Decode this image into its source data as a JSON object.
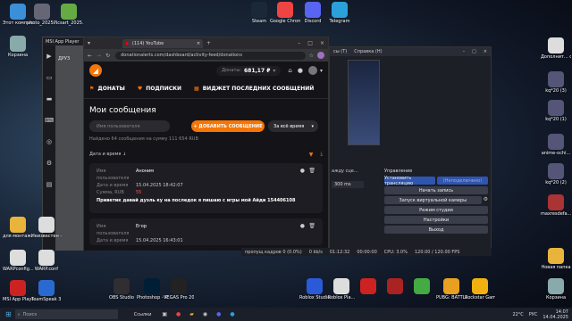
{
  "desktop": {
    "icons_left": [
      {
        "label": "Этот компьютер",
        "icon": "computer-icon",
        "color": "#3b8fd8"
      },
      {
        "label": "photo_2025...",
        "icon": "image-icon",
        "color": "#667"
      },
      {
        "label": "Picsart_2025...",
        "icon": "image-icon",
        "color": "#6a4"
      },
      {
        "label": "Корзина",
        "icon": "trash-icon",
        "color": "#8aa"
      },
      {
        "label": "для монтажа",
        "icon": "folder-icon",
        "color": "#e8b43c"
      },
      {
        "label": "Неизвестен - [Dub]sto...",
        "icon": "file-icon",
        "color": "#ddd"
      },
      {
        "label": "WARPconfig...",
        "icon": "file-icon",
        "color": "#ddd"
      },
      {
        "label": "WARP.conf",
        "icon": "file-icon",
        "color": "#ddd"
      },
      {
        "label": "MSI App Player",
        "icon": "msi-icon",
        "color": "#c22"
      },
      {
        "label": "TeamSpeak 3 Client",
        "icon": "teamspeak-icon",
        "color": "#2a6ad0"
      }
    ],
    "icons_top": [
      {
        "label": "Steam",
        "icon": "steam-icon",
        "color": "#1b2838"
      },
      {
        "label": "Google Chrome",
        "icon": "chrome-icon",
        "color": "#e44"
      },
      {
        "label": "Discord",
        "icon": "discord-icon",
        "color": "#5865f2"
      },
      {
        "label": "Telegram",
        "icon": "telegram-icon",
        "color": "#2aa1da"
      }
    ],
    "icons_right": [
      {
        "label": "Дополнит... сведения...",
        "icon": "file-icon",
        "color": "#ddd"
      },
      {
        "label": "kq*20 (3)",
        "icon": "image-icon",
        "color": "#557"
      },
      {
        "label": "kq*20 (1)",
        "icon": "image-icon",
        "color": "#557"
      },
      {
        "label": "anime-ochi...",
        "icon": "image-icon",
        "color": "#557"
      },
      {
        "label": "kq*20 (2)",
        "icon": "image-icon",
        "color": "#557"
      },
      {
        "label": "maxresdefa...",
        "icon": "image-icon",
        "color": "#a33"
      },
      {
        "label": "Новая папка",
        "icon": "folder-icon",
        "color": "#e8b43c"
      },
      {
        "label": "Корзина",
        "icon": "trash-icon",
        "color": "#8aa"
      }
    ],
    "icons_bottom": [
      {
        "label": "OBS Studio",
        "icon": "obs-icon",
        "color": "#302e31"
      },
      {
        "label": "Photoshop - Ярлык",
        "icon": "photoshop-icon",
        "color": "#001e36"
      },
      {
        "label": "VEGAS Pro 20.0",
        "icon": "vegas-icon",
        "color": "#222"
      },
      {
        "label": "Roblox Studio",
        "icon": "roblox-icon",
        "color": "#2a5ad8"
      },
      {
        "label": "Roblox Pla...",
        "icon": "roblox-icon",
        "color": "#ddd"
      },
      {
        "label": "",
        "icon": "game-icon",
        "color": "#c22"
      },
      {
        "label": "",
        "icon": "game-icon",
        "color": "#a22"
      },
      {
        "label": "",
        "icon": "game-icon",
        "color": "#4a4"
      },
      {
        "label": "PUBG: BATTLEGR...",
        "icon": "pubg-icon",
        "color": "#e8a020"
      },
      {
        "label": "Rockstar Games...",
        "icon": "rockstar-icon",
        "color": "#f0b010"
      }
    ]
  },
  "msi": {
    "title": "MSI App Player",
    "label": "ДРУЗ"
  },
  "browser": {
    "tab_title": "(114) YouTube",
    "url": "donationalerts.com/dashboard/activity-feed/donations"
  },
  "da": {
    "balance_label": "Донаты:",
    "balance_value": "681,17 ₽",
    "nav": [
      "ДОНАТЫ",
      "ПОДПИСКИ",
      "ВИДЖЕТ ПОСЛЕДНИХ СООБЩЕНИЙ"
    ],
    "section_title": "Мои сообщения",
    "search_placeholder": "Имя пользователя",
    "add_button": "+ ДОБАВИТЬ СООБЩЕНИЕ",
    "period": "За всё время",
    "found_text": "Найдено 64 сообщения на сумму 111 654 RUB",
    "sort_label": "Дата и время ↓",
    "donations": [
      {
        "user_label": "Имя пользователя",
        "user": "Аноним",
        "date_label": "Дата и время",
        "date": "15.04.2025 18:42:07",
        "sum_label": "Сумма, RUB",
        "sum": "55",
        "message": "Приветик давай дуэль ку на последок я пишаю с игры мой Айди 154406108"
      },
      {
        "user_label": "Имя пользователя",
        "user": "Егор",
        "date_label": "Дата и время",
        "date": "15.04.2025 16:43:01"
      }
    ]
  },
  "obs": {
    "menu": [
      "сы (Т)",
      "Справка (Н)"
    ],
    "scene_label": "ажду сце...",
    "duration": "300 ms",
    "controls_title": "Управление",
    "buttons": [
      "Установить трансляцию",
      "(Неподключено)",
      "Начать запись",
      "Запуск виртуальной камеры",
      "Режим студии",
      "Настройки",
      "Выход"
    ]
  },
  "status_bar": {
    "dropped": "пропущ кадров 0 (0.0%)",
    "kbps": "0 kb/s",
    "time1": "01:12:32",
    "time2": "00:00:00",
    "cpu": "CPU: 3.0%",
    "fps": "120.00 / 120.00 FPS"
  },
  "taskbar": {
    "search_placeholder": "Поиск",
    "weather": "Ссылки",
    "lang": "РУС",
    "time": "14:07",
    "date": "14.04.2025",
    "temp": "22°C"
  }
}
